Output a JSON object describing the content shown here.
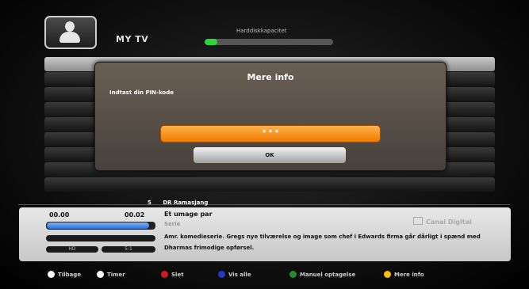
{
  "header": {
    "title": "MY TV",
    "capacity_label": "Harddiskkapacitet",
    "capacity_fraction": 0.1
  },
  "dialog": {
    "title": "Mere info",
    "prompt": "Indtast din PIN-kode",
    "pin_value": "* * *",
    "ok_label": "OK"
  },
  "channel": {
    "number": "5",
    "name": "DR Ramasjang"
  },
  "program": {
    "start": "00.00",
    "end": "00.02",
    "progress": 0.95,
    "title": "Et umage par",
    "genre": "Serie",
    "description": "Amr. komedieserie. Gregs nye tilværelse og image som chef i Edwards firma går dårligt i spænd med Dharmas frimodige opførsel.",
    "badge_hd": "HD",
    "badge_format": "5:1",
    "brand": "Canal Digital"
  },
  "footer": [
    {
      "label": "Tilbage",
      "color": "#ffffff",
      "icon": "back-icon"
    },
    {
      "label": "Timer",
      "color": "#ffffff",
      "icon": "play-icon"
    },
    {
      "label": "Slet",
      "color": "#d01a1a",
      "icon": "red-button-icon"
    },
    {
      "label": "Vis alle",
      "color": "#2637d0",
      "icon": "blue-button-icon"
    },
    {
      "label": "Manuel optagelse",
      "color": "#1f8f2a",
      "icon": "green-button-icon"
    },
    {
      "label": "Mere info",
      "color": "#f2c000",
      "icon": "yellow-button-icon"
    }
  ]
}
